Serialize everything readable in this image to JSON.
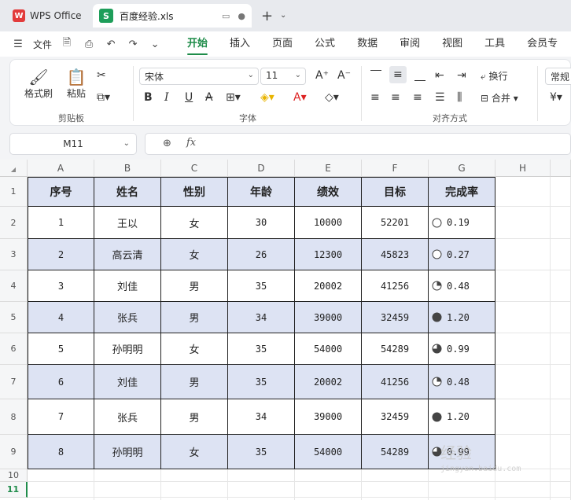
{
  "titlebar": {
    "app_name": "WPS Office",
    "file_tab": "百度经验.xls",
    "new_tab": "+"
  },
  "menubar": {
    "file_label": "文件",
    "tabs": [
      "开始",
      "插入",
      "页面",
      "公式",
      "数据",
      "审阅",
      "视图",
      "工具",
      "会员专"
    ]
  },
  "ribbon": {
    "clipboard": {
      "format_painter": "格式刷",
      "paste": "粘贴",
      "group": "剪贴板"
    },
    "font": {
      "name": "宋体",
      "size": "11",
      "group": "字体"
    },
    "align": {
      "wrap": "换行",
      "merge": "合并",
      "group": "对齐方式"
    },
    "number": {
      "format": "常规",
      "currency": "¥"
    }
  },
  "formula_bar": {
    "cell_ref": "M11",
    "formula": ""
  },
  "sheet": {
    "columns": [
      "A",
      "B",
      "C",
      "D",
      "E",
      "F",
      "G",
      "H"
    ],
    "rows": [
      "1",
      "2",
      "3",
      "4",
      "5",
      "6",
      "7",
      "8",
      "9",
      "10",
      "11"
    ],
    "headers": [
      "序号",
      "姓名",
      "性别",
      "年龄",
      "绩效",
      "目标",
      "完成率"
    ],
    "data": [
      [
        "1",
        "王以",
        "女",
        "30",
        "10000",
        "52201",
        "0.19"
      ],
      [
        "2",
        "高云清",
        "女",
        "26",
        "12300",
        "45823",
        "0.27"
      ],
      [
        "3",
        "刘佳",
        "男",
        "35",
        "20002",
        "41256",
        "0.48"
      ],
      [
        "4",
        "张兵",
        "男",
        "34",
        "39000",
        "32459",
        "1.20"
      ],
      [
        "5",
        "孙明明",
        "女",
        "35",
        "54000",
        "54289",
        "0.99"
      ],
      [
        "6",
        "刘佳",
        "男",
        "35",
        "20002",
        "41256",
        "0.48"
      ],
      [
        "7",
        "张兵",
        "男",
        "34",
        "39000",
        "32459",
        "1.20"
      ],
      [
        "8",
        "孙明明",
        "女",
        "35",
        "54000",
        "54289",
        "0.99"
      ]
    ],
    "rate_icons": [
      "circle-empty",
      "circle-empty",
      "circle-quarter",
      "circle-full",
      "circle-three-quarter",
      "circle-quarter",
      "circle-full",
      "circle-three-quarter"
    ],
    "band_color": "#dde3f3",
    "header_color": "#dde3f3"
  },
  "watermark": {
    "text": "经验",
    "url": "jingyan.baidu.com"
  }
}
